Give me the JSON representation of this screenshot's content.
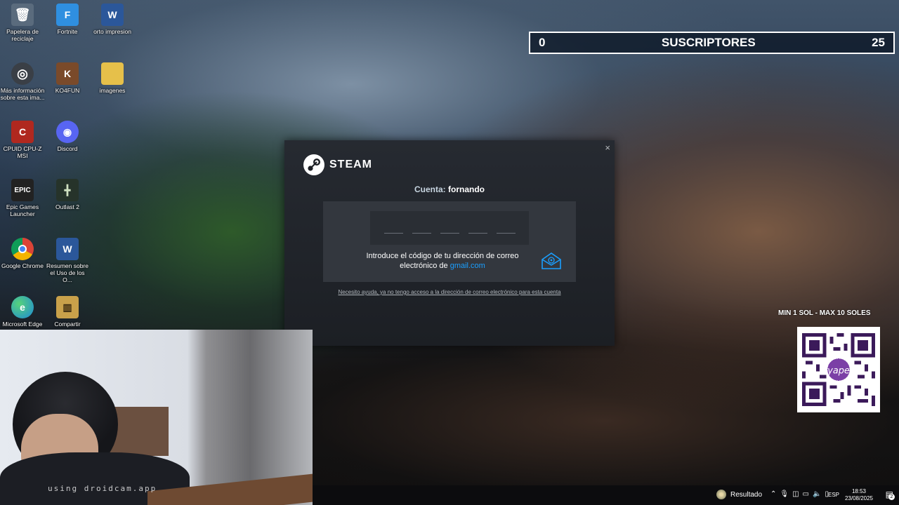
{
  "desktop": {
    "icons": [
      {
        "label": "Papelera de reciclaje",
        "glyph": "🗑",
        "color": "#5a6b7d"
      },
      {
        "label": "Fortnite",
        "glyph": "F",
        "color": "#2f8fe0"
      },
      {
        "label": "orto impresion",
        "glyph": "W",
        "color": "#2b579a"
      },
      {
        "label": "Más información sobre esta ima...",
        "glyph": "◎",
        "color": "#3a3f46"
      },
      {
        "label": "KO4FUN",
        "glyph": "K",
        "color": "#7a4a2a"
      },
      {
        "label": "imagenes",
        "glyph": "▰",
        "color": "#e6c04a"
      },
      {
        "label": "CPUID CPU-Z MSI",
        "glyph": "C",
        "color": "#b0281f"
      },
      {
        "label": "Discord",
        "glyph": "◉",
        "color": "#5865f2"
      },
      {
        "label": "Epic Games Launcher",
        "glyph": "EPIC",
        "color": "#222"
      },
      {
        "label": "Outlast 2",
        "glyph": "╋",
        "color": "#26332a"
      },
      {
        "label": "Google Chrome",
        "glyph": "◍",
        "color": "#db4437"
      },
      {
        "label": "Resumen sobre el Uso de los O...",
        "glyph": "W",
        "color": "#2b579a"
      },
      {
        "label": "Microsoft Edge",
        "glyph": "e",
        "color": "#1e8ad6"
      },
      {
        "label": "Compartir",
        "glyph": "▥",
        "color": "#c9a14a"
      }
    ]
  },
  "subscribers": {
    "left": "0",
    "title": "SUSCRIPTORES",
    "right": "25"
  },
  "steam": {
    "close": "×",
    "brand": "STEAM",
    "account_label": "Cuenta:",
    "account_name": "fornando",
    "instruction_line1": "Introduce el código de tu dirección de correo",
    "instruction_line2": "electrónico de",
    "email_domain": "gmail.com",
    "help_link": "Necesito ayuda, ya no tengo acceso a la dirección de correo electrónico para esta cuenta",
    "code_slots": 5,
    "mail_icon": "mail-at-icon"
  },
  "overlay": {
    "price": "MIN 1 SOL - MAX 10 SOLES",
    "qr_brand": "yape"
  },
  "webcam": {
    "watermark": "using droidcam.app"
  },
  "taskbar": {
    "weather": "Resultado",
    "tray_icons": [
      "chevron-up-icon",
      "mic-icon",
      "camera-icon",
      "network-icon",
      "speaker-icon",
      "battery-icon"
    ],
    "language": "ESP",
    "time": "18:53",
    "date": "23/08/2025",
    "notifications": "2"
  },
  "colors": {
    "steam_bg": "#1c1f24",
    "steam_link": "#1a9fff",
    "subs_border": "#ffffff"
  }
}
